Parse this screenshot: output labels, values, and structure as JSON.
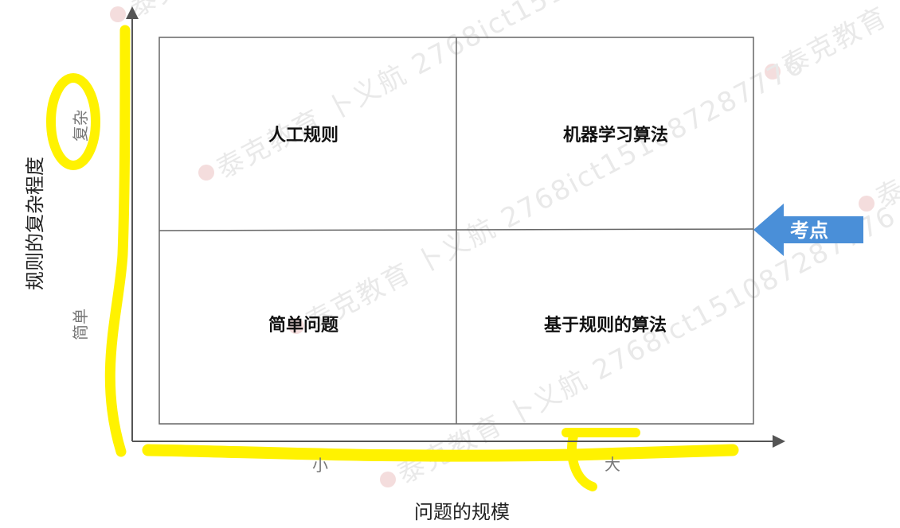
{
  "diagram": {
    "quadrants": {
      "top_left": "人工规则",
      "top_right": "机器学习算法",
      "bottom_left": "简单问题",
      "bottom_right": "基于规则的算法"
    },
    "y_axis": {
      "title": "规则的复杂程度",
      "high": "复杂",
      "low": "简单"
    },
    "x_axis": {
      "title": "问题的规模",
      "low": "小",
      "high": "大"
    },
    "callout": {
      "label": "考点",
      "color": "#4a8fd8"
    },
    "highlight_color": "#fff200"
  },
  "watermarks": [
    "泰克教育 卜义航 2768ict151087287776"
  ]
}
